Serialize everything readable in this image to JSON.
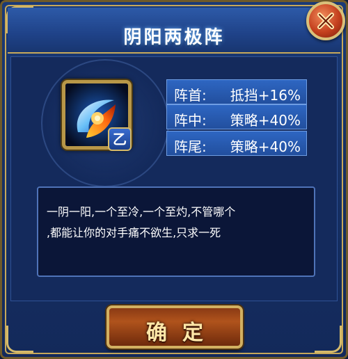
{
  "dialog": {
    "title": "阴阳两极阵",
    "close_label": "close"
  },
  "skill": {
    "icon": "yin-yang-fire-swirl-icon",
    "grade_badge": "乙"
  },
  "stats": [
    {
      "slot": "阵首:",
      "value": "抵挡+16%"
    },
    {
      "slot": "阵中:",
      "value": "策略+40%"
    },
    {
      "slot": "阵尾:",
      "value": "策略+40%"
    }
  ],
  "description": {
    "line1": "一阴一阳,一个至冷,一个至灼,不管哪个",
    "line2": ",都能让你的对手痛不欲生,只求一死"
  },
  "confirm_label": "确定",
  "colors": {
    "title_glow": "#6fb6ff",
    "stat_bg": "#2e66c2",
    "close_btn": "#c4401e",
    "confirm_btn": "#b0531c",
    "gold_border": "#d2b061"
  }
}
